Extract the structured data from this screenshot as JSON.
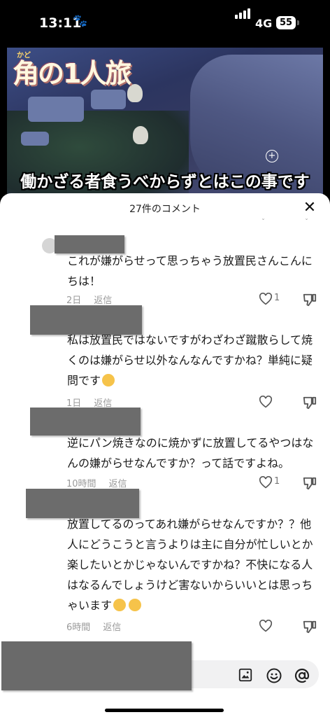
{
  "status_bar": {
    "time": "13:11",
    "network": "4G",
    "battery": "55"
  },
  "video": {
    "logo_ruby": "かど",
    "logo_text": "角の1人旅",
    "caption": "働かざる者食うべからずとはこの事です"
  },
  "comments_panel": {
    "title": "27件のコメント",
    "comments": [
      {
        "text": "これが嫌がらせって思っちゃう放置民さんこんにちは！",
        "time": "2日",
        "reply": "返信",
        "likes": "1"
      },
      {
        "text": "私は放置民ではないですがわざわざ蹴散らして焼くのは嫌がらせ以外なんなんですかね？単純に疑問です",
        "time": "1日",
        "reply": "返信",
        "likes": ""
      },
      {
        "text": "逆にパン焼きなのに焼かずに放置してるやつはなんの嫌がらせなんですか？って話ですよね。",
        "time": "10時間",
        "reply": "返信",
        "likes": "1"
      },
      {
        "text": "放置してるのってあれ嫌がらせなんですか？？他人にどうこうと言うよりは主に自分が忙しいとか楽したいとかじゃないんですかね？不快になる人はなるんでしょうけど害ないからいいとは思っちゃいます",
        "time": "6時間",
        "reply": "返信",
        "likes": ""
      }
    ]
  },
  "icons": [
    "heart-icon",
    "dislike-icon",
    "close-icon",
    "image-icon",
    "emoji-icon",
    "mention-icon"
  ]
}
